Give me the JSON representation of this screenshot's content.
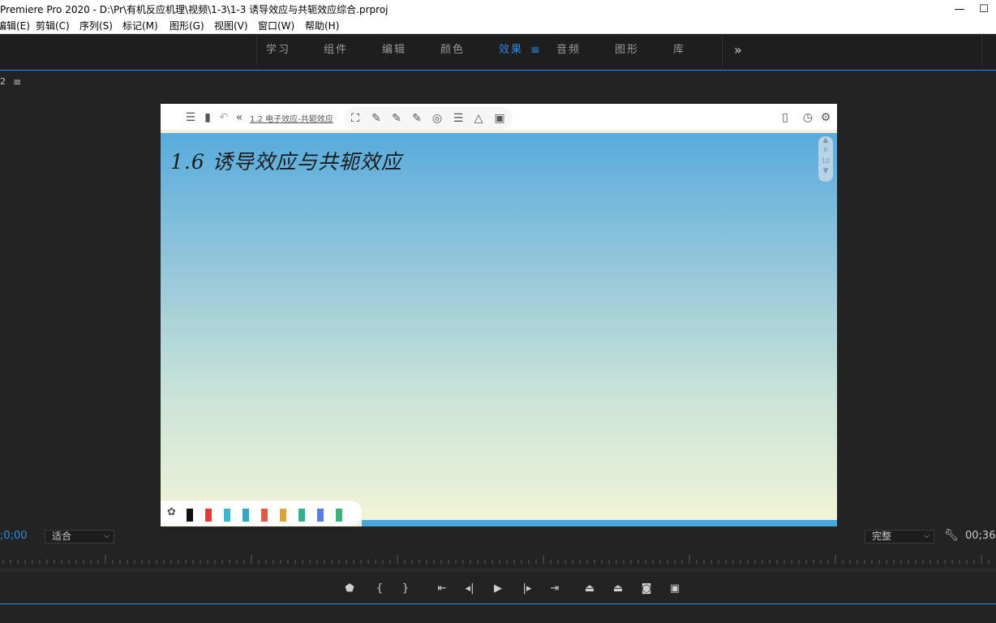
{
  "window": {
    "title": "Premiere Pro 2020 - D:\\Pr\\有机反应机理\\视频\\1-3\\1-3 诱导效应与共轭效应综合.prproj",
    "minimize": "—",
    "restore": "☐"
  },
  "menu": [
    "编辑(E)",
    "剪辑(C)",
    "序列(S)",
    "标记(M)",
    "图形(G)",
    "视图(V)",
    "窗口(W)",
    "帮助(H)"
  ],
  "workspaces": {
    "tabs": [
      "学习",
      "组件",
      "编辑",
      "颜色",
      "效果",
      "音频",
      "图形",
      "库"
    ],
    "active": "效果",
    "more": "»",
    "menu_icon": "≡"
  },
  "panel": {
    "header": "2",
    "menu_icon": "≡"
  },
  "video": {
    "breadcrumb": "1.2 电子效应-共轭效应",
    "handwritten_title": "1.6  诱导效应与共轭效应",
    "page_current": "6",
    "page_total": "10"
  },
  "monitor": {
    "timecode_left": ";0;00",
    "fit_value": "适合",
    "quality_value": "完整",
    "timecode_right": "00;36"
  },
  "colors": {
    "accent": "#2d8ceb",
    "bg": "#232323"
  }
}
